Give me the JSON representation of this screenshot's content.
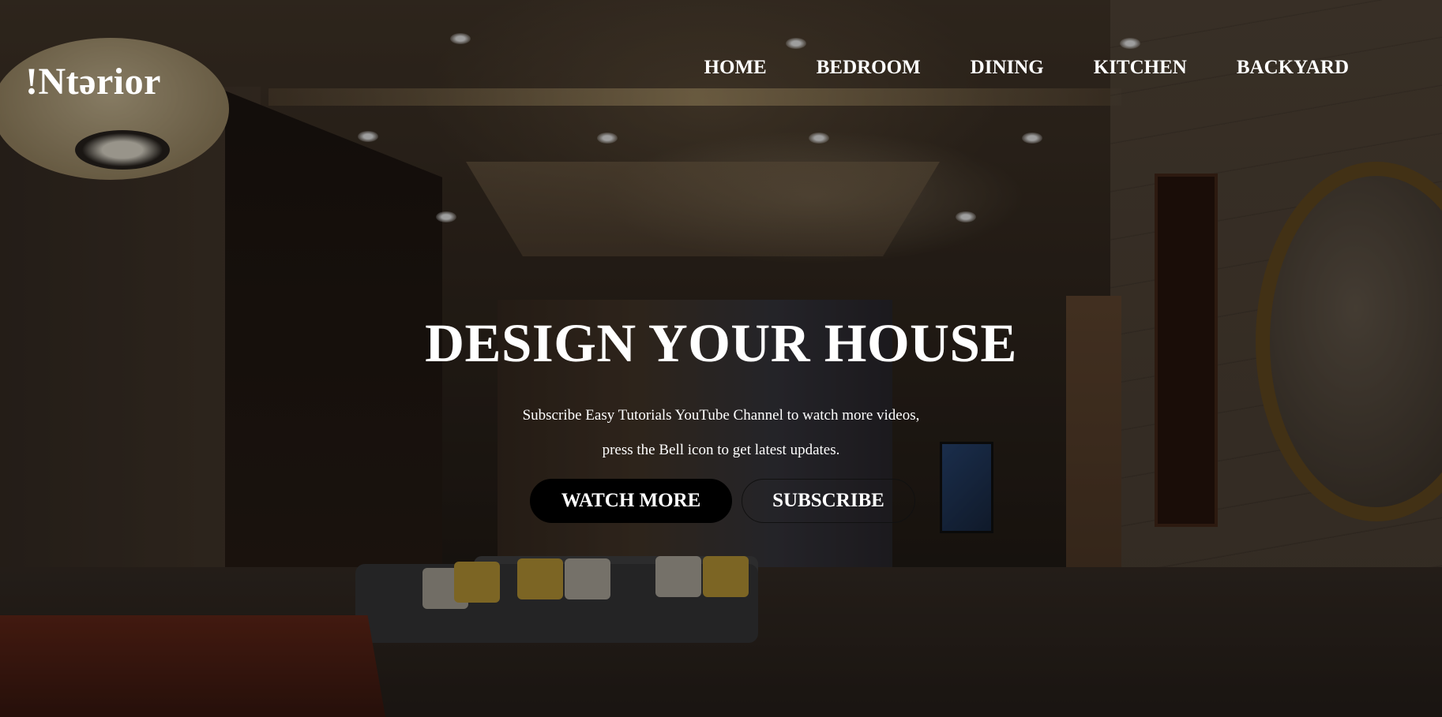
{
  "header": {
    "logo": "!Ntərior",
    "nav": [
      "HOME",
      "BEDROOM",
      "DINING",
      "KITCHEN",
      "BACKYARD"
    ]
  },
  "hero": {
    "headline": "DESIGN YOUR HOUSE",
    "subtext_line1": "Subscribe Easy Tutorials YouTube Channel to watch more videos,",
    "subtext_line2": "press the Bell icon to get latest updates.",
    "primary_button": "WATCH MORE",
    "secondary_button": "SUBSCRIBE",
    "background_image": "interior living room"
  },
  "colors": {
    "text": "#ffffff",
    "primary_button_bg": "#000000",
    "overlay": "rgba(0,0,0,0.38)"
  }
}
